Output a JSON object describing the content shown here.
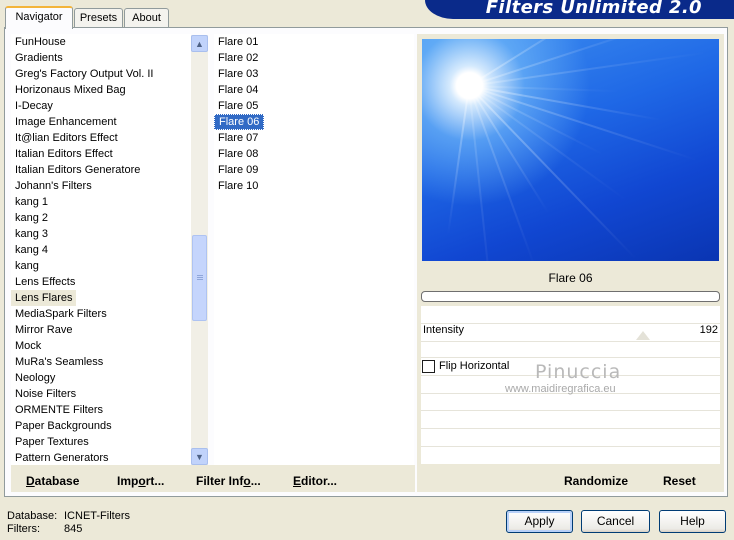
{
  "tabs": [
    {
      "label": "Navigator",
      "active": true
    },
    {
      "label": "Presets",
      "active": false
    },
    {
      "label": "About",
      "active": false
    }
  ],
  "app_title": "Filters Unlimited 2.0",
  "categories": {
    "items": [
      "FunHouse",
      "Gradients",
      "Greg's Factory Output Vol. II",
      "Horizonaus Mixed Bag",
      "I-Decay",
      "Image Enhancement",
      "It@lian Editors Effect",
      "Italian Editors Effect",
      "Italian Editors Generatore",
      "Johann's Filters",
      "kang 1",
      "kang 2",
      "kang 3",
      "kang 4",
      "kang",
      "Lens Effects",
      "Lens Flares",
      "MediaSpark Filters",
      "Mirror Rave",
      "Mock",
      "MuRa's Seamless",
      "Neology",
      "Noise Filters",
      "ORMENTE Filters",
      "Paper Backgrounds",
      "Paper Textures",
      "Pattern Generators"
    ],
    "selected": "Lens Flares"
  },
  "filters": {
    "items": [
      "Flare 01",
      "Flare 02",
      "Flare 03",
      "Flare 04",
      "Flare 05",
      "Flare 06",
      "Flare 07",
      "Flare 08",
      "Flare 09",
      "Flare 10"
    ],
    "selected": "Flare 06"
  },
  "bottom_buttons": {
    "database": "Database",
    "import": "Import...",
    "filter_info": "Filter Info...",
    "editor": "Editor..."
  },
  "preview": {
    "filter_name": "Flare 06",
    "progress": 0,
    "colors": {
      "sky": "#1f68e6",
      "flare": "#ffffff"
    }
  },
  "params": {
    "intensity_label": "Intensity",
    "intensity_value": "192",
    "intensity_max": 255,
    "flip_label": "Flip Horizontal",
    "flip_checked": false
  },
  "watermark": {
    "name": "Pinuccia",
    "site": "www.maidiregrafica.eu"
  },
  "right_buttons": {
    "randomize": "Randomize",
    "reset": "Reset"
  },
  "status": {
    "database_label": "Database:",
    "database_value": "ICNET-Filters",
    "filters_label": "Filters:",
    "filters_value": "845"
  },
  "dialog_buttons": {
    "apply": "Apply",
    "cancel": "Cancel",
    "help": "Help"
  },
  "icons": {
    "scroll_up": "chevron-up-icon",
    "scroll_down": "chevron-down-icon"
  },
  "accent": "#316ac5"
}
